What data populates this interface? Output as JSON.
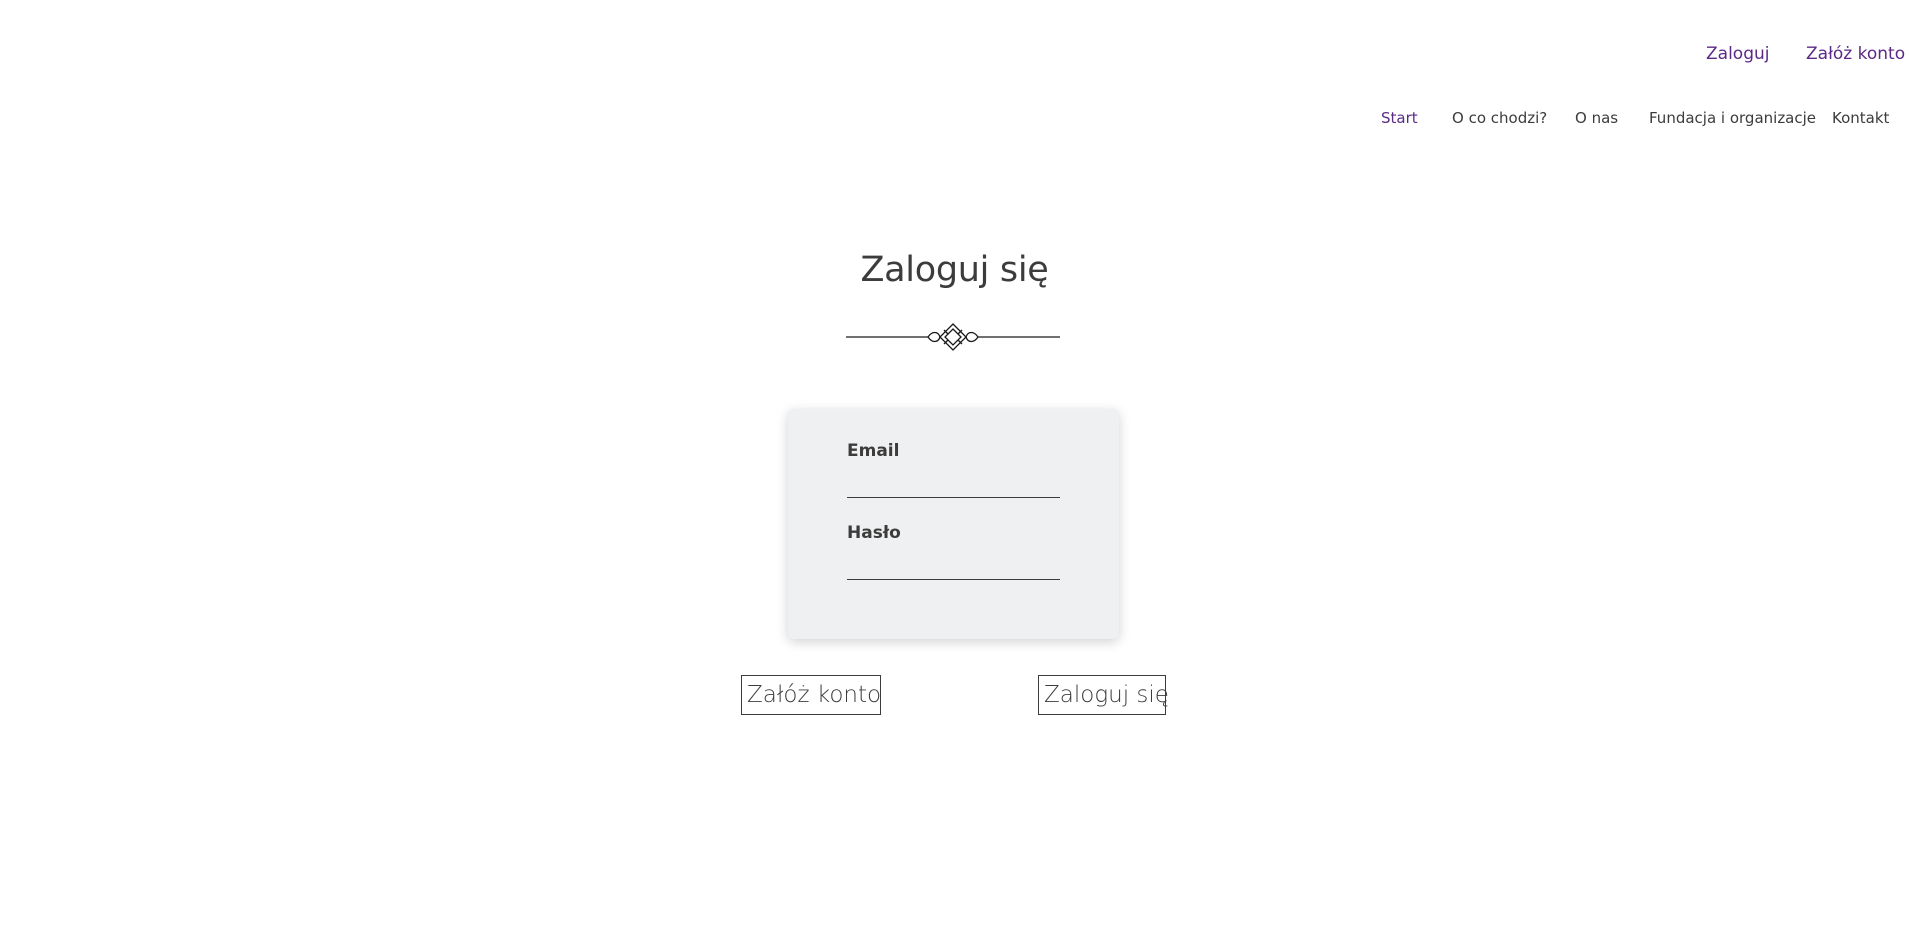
{
  "auth": {
    "login_label": "Zaloguj",
    "register_label": "Załóż konto"
  },
  "nav": {
    "items": [
      {
        "label": "Start",
        "active": true
      },
      {
        "label": "O co chodzi?",
        "active": false
      },
      {
        "label": "O nas",
        "active": false
      },
      {
        "label": "Fundacja i organizacje",
        "active": false
      },
      {
        "label": "Kontakt",
        "active": false
      }
    ]
  },
  "main": {
    "title": "Zaloguj się",
    "ornament_icon": "decorative-divider-icon"
  },
  "form": {
    "email_label": "Email",
    "email_value": "",
    "password_label": "Hasło",
    "password_value": ""
  },
  "actions": {
    "register_button": "Załóż konto",
    "login_button": "Zaloguj się"
  },
  "colors": {
    "accent": "#5b2a86",
    "text": "#3c3c3c",
    "card_background": "#eff0f1"
  }
}
